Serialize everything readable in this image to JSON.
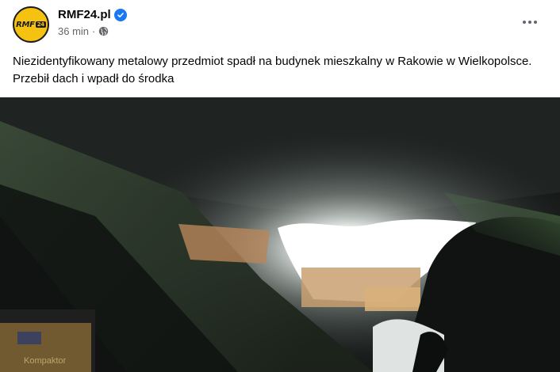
{
  "post": {
    "page_name": "RMF24.pl",
    "avatar_text": "RMF",
    "avatar_badge": "24",
    "timestamp": "36 min",
    "separator": "·",
    "caption": "Niezidentyfikowany metalowy przedmiot spadł na budynek mieszkalny w Rakowie w Wielkopolsce. Przebił dach i wpadł do środka",
    "photo_box_text": "Kompaktor"
  },
  "icons": {
    "verified": "verified-badge-icon",
    "audience": "globe-icon",
    "more": "more-options-icon"
  },
  "colors": {
    "brand_yellow": "#f5c211",
    "verified_blue": "#1877f2",
    "meta_gray": "#65676b"
  }
}
